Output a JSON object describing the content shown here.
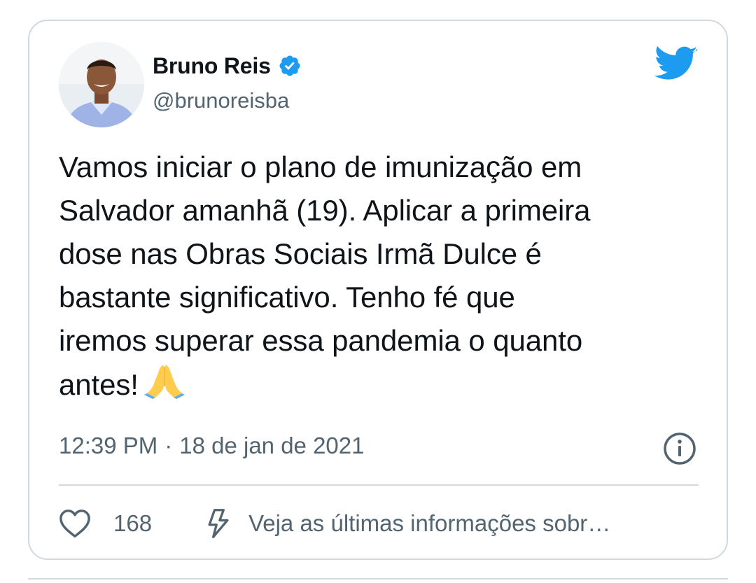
{
  "author": {
    "display_name": "Bruno Reis",
    "handle": "@brunoreisba",
    "verified": true,
    "avatar_icon": "avatar-photo"
  },
  "tweet": {
    "text": "Vamos iniciar o plano de imunização em\nSalvador amanhã (19). Aplicar a primeira\ndose nas Obras Sociais Irmã Dulce é\nbastante significativo. Tenho fé que\niremos superar essa pandemia o quanto\nantes!",
    "emoji": "folded-hands-emoji",
    "time": "12:39 PM",
    "separator": "·",
    "date": "18 de jan de 2021"
  },
  "actions": {
    "like_count": "168",
    "info_text": "Veja as últimas informações sobr…"
  },
  "icons": {
    "brand": "twitter-bird-icon",
    "verified": "verified-badge-icon",
    "info": "info-icon",
    "like": "heart-icon",
    "news": "lightning-icon"
  },
  "colors": {
    "twitter_blue": "#1d9bf0",
    "text_primary": "#0f1419",
    "text_secondary": "#536471",
    "border": "#cfd9de"
  }
}
